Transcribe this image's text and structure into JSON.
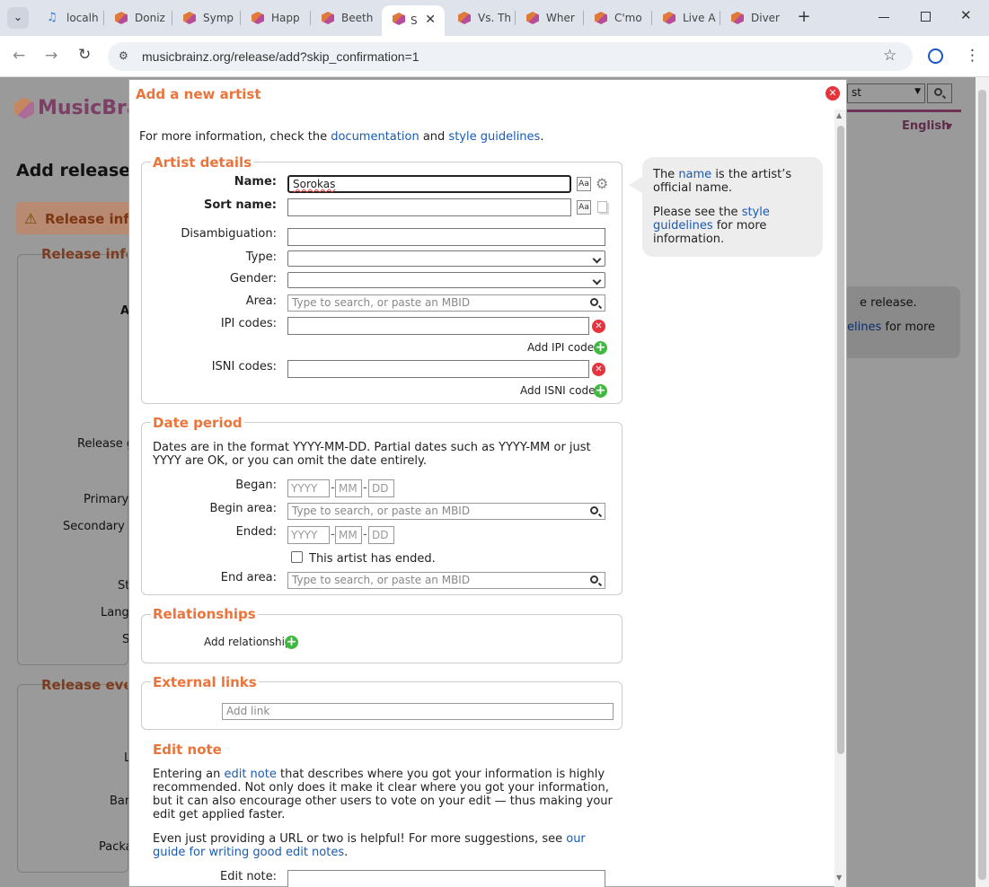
{
  "tabs": [
    {
      "title": "localh"
    },
    {
      "title": "Doniz"
    },
    {
      "title": "Symp"
    },
    {
      "title": "Happ"
    },
    {
      "title": "Beeth"
    },
    {
      "title": "S"
    },
    {
      "title": "Vs. Th"
    },
    {
      "title": "Wher"
    },
    {
      "title": "C'mo"
    },
    {
      "title": "Live A"
    },
    {
      "title": "Diver"
    }
  ],
  "address_bar": {
    "url": "musicbrainz.org/release/add?skip_confirmation=1"
  },
  "background_page": {
    "logo": "MusicBra",
    "heading": "Add release",
    "warning": "Release info",
    "section1": "Release info",
    "section2": "Release eve",
    "lang": "English",
    "search_value": "st",
    "labels": [
      "A",
      "Release g",
      "Primary",
      "Secondary t",
      "St",
      "Lang",
      "S",
      "L",
      "Bar",
      "Packa"
    ],
    "side_text1": "e release.",
    "side_link": "elines",
    "side_text2": " for more"
  },
  "dialog": {
    "title": "Add a new artist",
    "intro_prefix": "For more information, check the ",
    "intro_link1": "documentation",
    "intro_mid": " and ",
    "intro_link2": "style guidelines",
    "intro_suffix": ".",
    "artist_details": {
      "legend": "Artist details",
      "name_label": "Name:",
      "name_value": "Sorokas",
      "sort_name_label": "Sort name:",
      "sort_name_value": "",
      "disambiguation_label": "Disambiguation:",
      "type_label": "Type:",
      "gender_label": "Gender:",
      "area_label": "Area:",
      "area_placeholder": "Type to search, or paste an MBID",
      "ipi_label": "IPI codes:",
      "add_ipi": "Add IPI code",
      "isni_label": "ISNI codes:",
      "add_isni": "Add ISNI code"
    },
    "tooltip": {
      "p1_prefix": "The ",
      "p1_link": "name",
      "p1_suffix": " is the artist’s official name.",
      "p2_prefix": "Please see the ",
      "p2_link": "style guidelines",
      "p2_suffix": " for more information."
    },
    "date_period": {
      "legend": "Date period",
      "help": "Dates are in the format YYYY-MM-DD. Partial dates such as YYYY-MM or just YYYY are OK, or you can omit the date entirely.",
      "began_label": "Began:",
      "begin_area_label": "Begin area:",
      "ended_label": "Ended:",
      "ended_checkbox": "This artist has ended.",
      "end_area_label": "End area:",
      "yyyy": "YYYY",
      "mm": "MM",
      "dd": "DD",
      "area_placeholder": "Type to search, or paste an MBID"
    },
    "relationships": {
      "legend": "Relationships",
      "add": "Add relationship"
    },
    "external_links": {
      "legend": "External links",
      "placeholder": "Add link"
    },
    "edit_note": {
      "legend": "Edit note",
      "p1_prefix": "Entering an ",
      "p1_link": "edit note",
      "p1_suffix": " that describes where you got your information is highly recommended. Not only does it make it clear where you got your information, but it can also encourage other users to vote on your edit — thus making your edit get applied faster.",
      "p2_prefix": "Even just providing a URL or two is helpful! For more suggestions, see ",
      "p2_link": "our guide for writing good edit notes",
      "p2_suffix": ".",
      "label": "Edit note:"
    }
  }
}
